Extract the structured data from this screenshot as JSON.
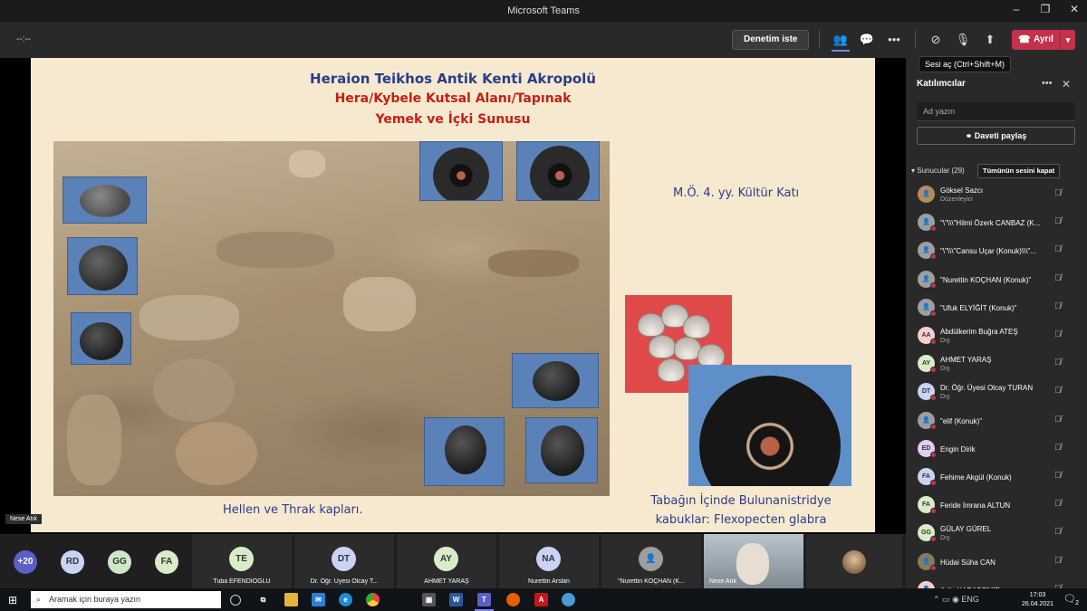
{
  "window": {
    "title": "Microsoft Teams"
  },
  "toolbar": {
    "timer": "--:--",
    "record_label": "Denetim iste",
    "leave_label": "Ayrıl",
    "mic_tooltip": "Sesi aç (Ctrl+Shift+M)"
  },
  "slide": {
    "title1": "Heraion Teikhos Antik Kenti Akropolü",
    "title2": "Hera/Kybele Kutsal Alanı/Tapınak",
    "title3": "Yemek ve İçki Sunusu",
    "period": "M.Ö. 4. yy. Kültür Katı",
    "caption_left": "Hellen ve Thrak kapları.",
    "caption_right_1": "Tabağın İçinde Bulunanistridye",
    "caption_right_2": "kabuklar:  Flexopecten glabra"
  },
  "stage": {
    "presenter_tag": "Nese Atık"
  },
  "strip": {
    "more": "+20",
    "avatars": [
      {
        "initials": "RD",
        "color": "#c9d4f5"
      },
      {
        "initials": "GG",
        "color": "#cfe8c8"
      },
      {
        "initials": "FA",
        "color": "#d8ecc8"
      }
    ],
    "tiles": [
      {
        "initials": "TE",
        "name": "Tuba EFENDİOĞLU",
        "color": "#d8ecc8"
      },
      {
        "initials": "DT",
        "name": "Dr. Öğr. Üyesi Olcay T...",
        "color": "#c9d4f5"
      },
      {
        "initials": "AY",
        "name": "AHMET YARAŞ",
        "color": "#d8ecc8"
      },
      {
        "initials": "NA",
        "name": "Nurettin Arslan",
        "color": "#c9d4f5"
      },
      {
        "initials": "",
        "name": "\"Nurettin KOÇHAN (K...",
        "color": "#9e9e9e"
      },
      {
        "initials": "",
        "name": "Nese Atık",
        "color": "#cfc7bd"
      }
    ]
  },
  "panel": {
    "title": "Katılımcılar",
    "search_placeholder": "Ad yazın",
    "share_label": "Daveti paylaş",
    "section_label": "Sunucular (29)",
    "mute_all_label": "Tümünün sesini kapat",
    "participants": [
      {
        "initials": "",
        "name": "Göksel Sazcı",
        "sub": "Düzenleyici",
        "color": "#b58a5e"
      },
      {
        "initials": "",
        "name": "\"\\\"\\\\\\\"Hilmi Özerk CANBAZ (K...",
        "sub": "",
        "color": "#9e9e9e"
      },
      {
        "initials": "",
        "name": "\"\\\"\\\\\\\"Cansu Uçar (Konuk)\\\\\\\"...",
        "sub": "",
        "color": "#9e9e9e"
      },
      {
        "initials": "",
        "name": "\"Nurettin KOÇHAN (Konuk)\"",
        "sub": "",
        "color": "#9e9e9e"
      },
      {
        "initials": "",
        "name": "\"Ufuk ELYİĞİT (Konuk)\"",
        "sub": "",
        "color": "#9e9e9e"
      },
      {
        "initials": "AA",
        "name": "Abdülkerim Buğra ATEŞ",
        "sub": "Dış",
        "color": "#f5cfc9"
      },
      {
        "initials": "AY",
        "name": "AHMET YARAŞ",
        "sub": "Dış",
        "color": "#d8ecc8"
      },
      {
        "initials": "DT",
        "name": "Dr. Öğr. Üyesi Olcay TURAN",
        "sub": "Dış",
        "color": "#c9d4f5"
      },
      {
        "initials": "",
        "name": "\"elif (Konuk)\"",
        "sub": "",
        "color": "#9e9e9e"
      },
      {
        "initials": "ED",
        "name": "Engin Dirik",
        "sub": "",
        "color": "#e3cdf0"
      },
      {
        "initials": "FA",
        "name": "Fehime Akgül (Konuk)",
        "sub": "",
        "color": "#c9d4f5"
      },
      {
        "initials": "FA",
        "name": "Feride İmrana ALTUN",
        "sub": "",
        "color": "#d8ecc8"
      },
      {
        "initials": "GG",
        "name": "GÜLAY GÜREL",
        "sub": "Dış",
        "color": "#d8ecc8"
      },
      {
        "initials": "",
        "name": "Hüdai Süha CAN",
        "sub": "",
        "color": "#8a7a5a"
      },
      {
        "initials": "",
        "name": "Jella KARADEMİR",
        "sub": "",
        "color": "#f5cfc9"
      }
    ]
  },
  "taskbar": {
    "search_placeholder": "Aramak için buraya yazın",
    "time": "17:03",
    "date": "26.04.2021",
    "notif_count": "2"
  }
}
